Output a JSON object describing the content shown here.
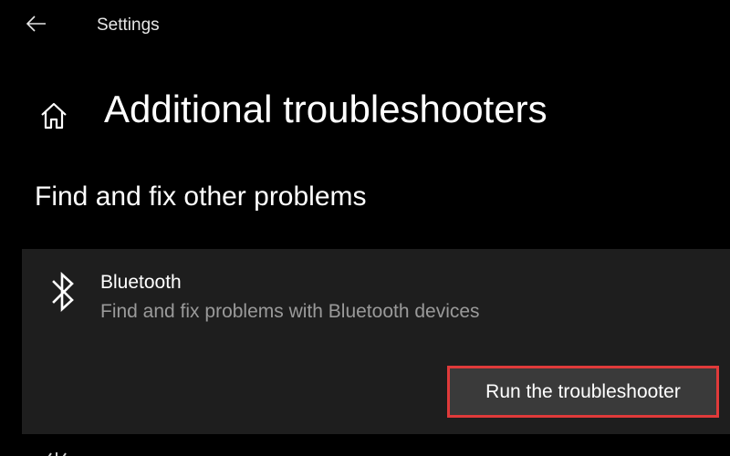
{
  "titlebar": {
    "back_icon": "back-arrow-icon",
    "title": "Settings"
  },
  "header": {
    "home_icon": "home-icon",
    "page_title": "Additional troubleshooters"
  },
  "section": {
    "heading": "Find and fix other problems"
  },
  "troubleshooters": [
    {
      "icon": "bluetooth-icon",
      "title": "Bluetooth",
      "description": "Find and fix problems with Bluetooth devices",
      "button_label": "Run the troubleshooter",
      "highlighted": true
    }
  ],
  "colors": {
    "background": "#000000",
    "card_background": "#1e1e1e",
    "button_background": "#3a3a3a",
    "highlight_border": "#e03a3a",
    "secondary_text": "#9a9a9a"
  }
}
